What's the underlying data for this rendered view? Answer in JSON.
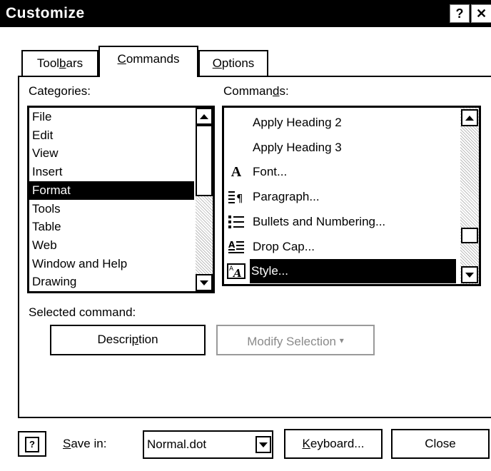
{
  "window": {
    "title": "Customize",
    "help_glyph": "?",
    "close_glyph": "✕"
  },
  "tabs": [
    {
      "label_pre": "Tool",
      "label_key": "b",
      "label_post": "ars"
    },
    {
      "label_pre": "",
      "label_key": "C",
      "label_post": "ommands"
    },
    {
      "label_pre": "",
      "label_key": "O",
      "label_post": "ptions"
    }
  ],
  "categories": {
    "label_pre": "Cate",
    "label_key": "g",
    "label_post": "ories:",
    "items": [
      "File",
      "Edit",
      "View",
      "Insert",
      "Format",
      "Tools",
      "Table",
      "Web",
      "Window and Help",
      "Drawing"
    ],
    "selected_index": 4
  },
  "commands": {
    "label_pre": "Comman",
    "label_key": "d",
    "label_post": "s:",
    "items": [
      {
        "label": "Apply Heading 2",
        "icon": "none"
      },
      {
        "label": "Apply Heading 3",
        "icon": "none"
      },
      {
        "label": "Font...",
        "icon": "font-icon"
      },
      {
        "label": "Paragraph...",
        "icon": "paragraph-icon"
      },
      {
        "label": "Bullets and Numbering...",
        "icon": "bullets-icon"
      },
      {
        "label": "Drop Cap...",
        "icon": "drop-cap-icon"
      },
      {
        "label": "Style...",
        "icon": "style-icon"
      }
    ],
    "selected_index": 6
  },
  "selected_command": {
    "label": "Selected command:"
  },
  "buttons": {
    "description_pre": "Descri",
    "description_key": "p",
    "description_post": "tion",
    "modify_selection": "Modify Selection",
    "modify_arrow": "▾",
    "keyboard_pre": "",
    "keyboard_key": "K",
    "keyboard_post": "eyboard...",
    "close": "Close",
    "help_glyph": "?"
  },
  "save_in": {
    "label_pre": "",
    "label_key": "S",
    "label_post": "ave in:",
    "value": "Normal.dot"
  }
}
